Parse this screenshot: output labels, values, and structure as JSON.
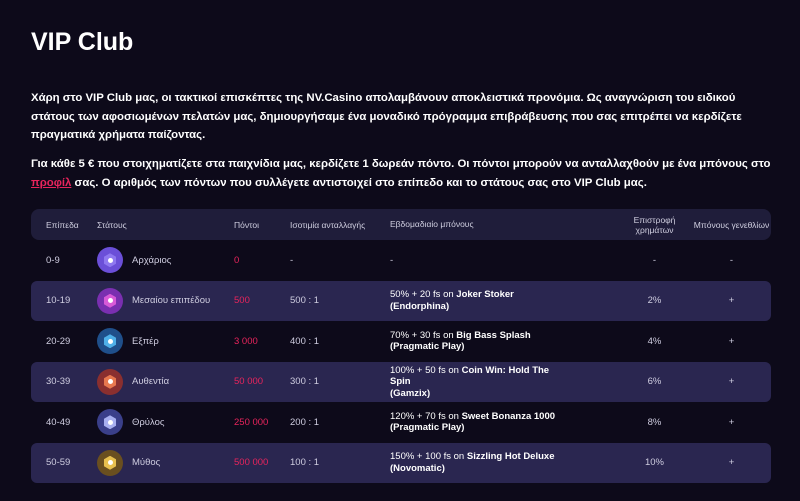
{
  "page": {
    "title": "VIP Club",
    "intro": "Χάρη στο VIP Club μας, οι τακτικοί επισκέπτες της NV.Casino απολαμβάνουν αποκλειστικά προνόμια. Ως αναγνώριση του ειδικού στάτους των αφοσιωμένων πελατών μας, δημιουργήσαμε ένα μοναδικό πρόγραμμα επιβράβευσης που σας επιτρέπει να κερδίζετε πραγματικά χρήματα παίζοντας.",
    "rules_before_link": "Για κάθε 5 € που στοιχηματίζετε στα παιχνίδια μας, κερδίζετε 1 δωρεάν πόντο. Οι πόντοι μπορούν να ανταλλαχθούν με ένα μπόνους στο ",
    "rules_link": "προφίλ",
    "rules_after_link": " σας. Ο αριθμός των πόντων που συλλέγετε αντιστοιχεί στο επίπεδο και το στάτους σας στο VIP Club μας."
  },
  "table": {
    "headers": {
      "level": "Επίπεδα",
      "status": "Στάτους",
      "points": "Πόντοι",
      "rate": "Ισοτιμία ανταλλαγής",
      "weekly": "Εβδομαδιαίο μπόνους",
      "cashback": "Επιστροφή χρημάτων",
      "birthday": "Μπόνους γενεθλίων"
    },
    "rows": [
      {
        "level": "0-9",
        "status": "Αρχάριος",
        "points": "0",
        "rate": "-",
        "weekly_pre": "-",
        "weekly_game": "",
        "weekly_provider": "",
        "cashback": "-",
        "birthday": "-",
        "badge_color": "#6b4fd8",
        "hex_color": "#8f78f0"
      },
      {
        "level": "10-19",
        "status": "Μεσαίου επιπέδου",
        "points": "500",
        "rate": "500 : 1",
        "weekly_pre": "50% + 20 fs on ",
        "weekly_game": "Joker Stoker",
        "weekly_provider": "(Endorphina)",
        "cashback": "2%",
        "birthday": "+",
        "badge_color": "#7a2fb0",
        "hex_color": "#d85ad8"
      },
      {
        "level": "20-29",
        "status": "Εξπέρ",
        "points": "3 000",
        "rate": "400 : 1",
        "weekly_pre": "70% + 30 fs on ",
        "weekly_game": "Big Bass Splash",
        "weekly_provider": "(Pragmatic Play)",
        "cashback": "4%",
        "birthday": "+",
        "badge_color": "#1f4f8a",
        "hex_color": "#4fb0e8"
      },
      {
        "level": "30-39",
        "status": "Αυθεντία",
        "points": "50 000",
        "rate": "300 : 1",
        "weekly_pre": "100% + 50 fs on ",
        "weekly_game": "Coin Win: Hold The Spin",
        "weekly_provider": "(Gamzix)",
        "cashback": "6%",
        "birthday": "+",
        "badge_color": "#8a2f2f",
        "hex_color": "#e8784f"
      },
      {
        "level": "40-49",
        "status": "Θρύλος",
        "points": "250 000",
        "rate": "200 : 1",
        "weekly_pre": "120% + 70 fs on ",
        "weekly_game": "Sweet Bonanza 1000",
        "weekly_provider": "(Pragmatic Play)",
        "cashback": "8%",
        "birthday": "+",
        "badge_color": "#3a3f8a",
        "hex_color": "#a8b0f0"
      },
      {
        "level": "50-59",
        "status": "Μύθος",
        "points": "500 000",
        "rate": "100 : 1",
        "weekly_pre": "150% + 100 fs on ",
        "weekly_game": "Sizzling Hot Deluxe",
        "weekly_provider": "(Novomatic)",
        "cashback": "10%",
        "birthday": "+",
        "badge_color": "#6a4f1f",
        "hex_color": "#e8c04f"
      }
    ]
  }
}
